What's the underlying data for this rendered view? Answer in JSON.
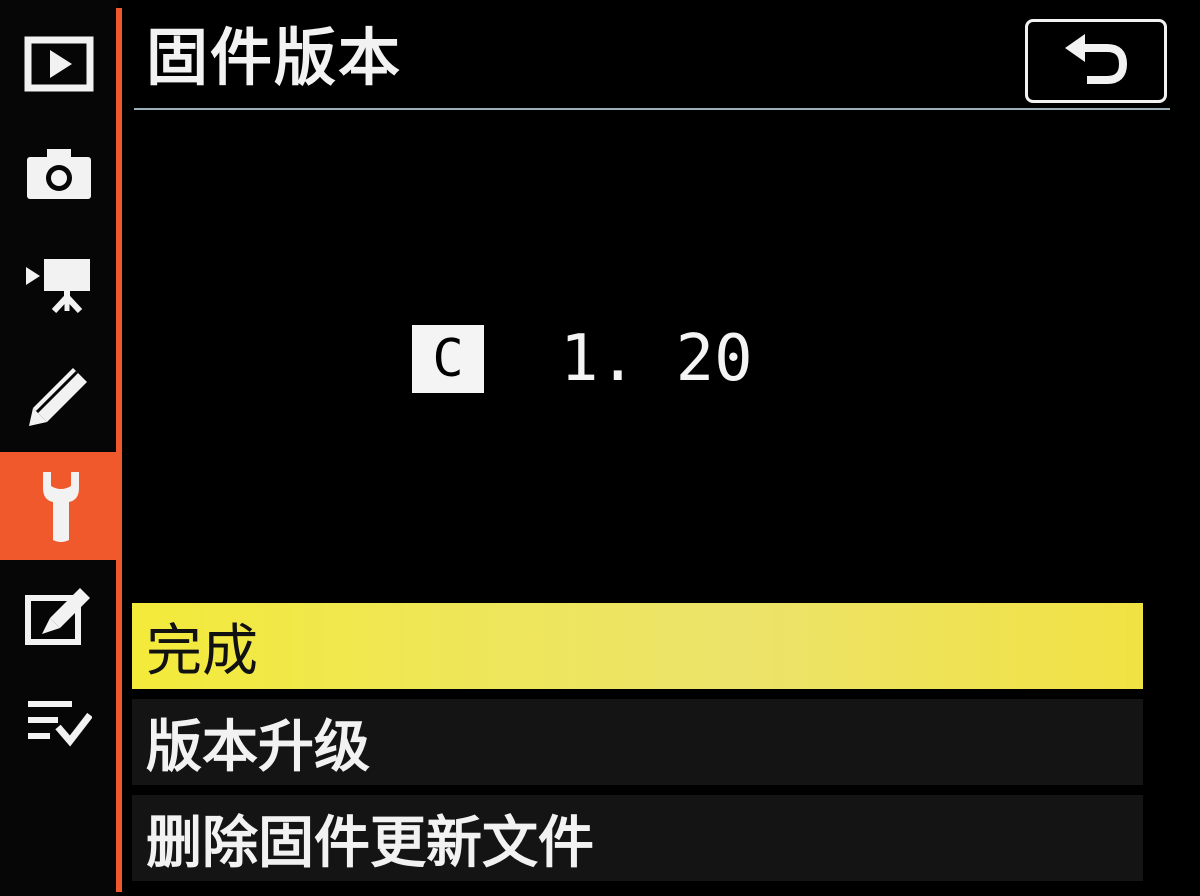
{
  "header": {
    "title": "固件版本",
    "back_icon": "return-arrow-icon"
  },
  "sidebar": {
    "items": [
      {
        "icon": "playback-icon",
        "active": false
      },
      {
        "icon": "camera-icon",
        "active": false
      },
      {
        "icon": "movie-camera-icon",
        "active": false
      },
      {
        "icon": "pencil-icon",
        "active": false
      },
      {
        "icon": "wrench-icon",
        "active": true
      },
      {
        "icon": "retouch-icon",
        "active": false
      },
      {
        "icon": "my-menu-icon",
        "active": false
      }
    ]
  },
  "firmware": {
    "badge": "C",
    "version": "1. 20"
  },
  "menu": {
    "items": [
      {
        "label": "完成",
        "selected": true
      },
      {
        "label": "版本升级",
        "selected": false
      },
      {
        "label": "删除固件更新文件",
        "selected": false
      }
    ]
  },
  "colors": {
    "accent": "#f0592b",
    "highlight": "#f3ea3a",
    "background": "#000000"
  }
}
